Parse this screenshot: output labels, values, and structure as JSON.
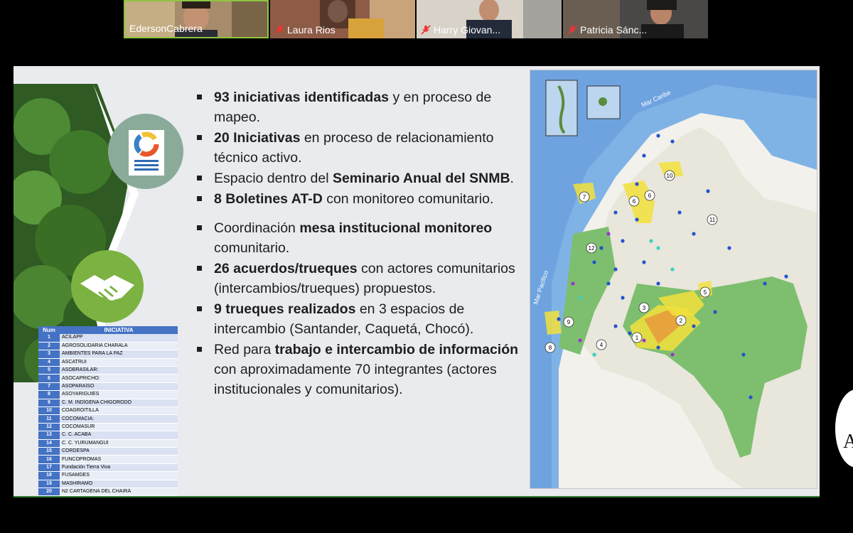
{
  "participants": [
    {
      "name": "EdersonCabrera",
      "muted": false,
      "active": true
    },
    {
      "name": "Laura Rios",
      "muted": true,
      "active": false
    },
    {
      "name": "Harry Giovan...",
      "muted": true,
      "active": false
    },
    {
      "name": "Patricia Sánc...",
      "muted": true,
      "active": false
    }
  ],
  "slide": {
    "bullets": [
      {
        "parts": [
          {
            "t": "93 iniciativas identificadas",
            "b": true
          },
          {
            "t": " y en proceso de mapeo.",
            "b": false
          }
        ]
      },
      {
        "parts": [
          {
            "t": "20 Iniciativas",
            "b": true
          },
          {
            "t": " en proceso de relacionamiento técnico activo.",
            "b": false
          }
        ]
      },
      {
        "parts": [
          {
            "t": "Espacio dentro del ",
            "b": false
          },
          {
            "t": "Seminario Anual del SNMB",
            "b": true
          },
          {
            "t": ".",
            "b": false
          }
        ]
      },
      {
        "parts": [
          {
            "t": "8 Boletines AT-D",
            "b": true
          },
          {
            "t": " con monitoreo comunitario.",
            "b": false
          }
        ]
      },
      {
        "parts": [
          {
            "t": "Coordinación ",
            "b": false
          },
          {
            "t": "mesa institucional monitoreo",
            "b": true
          },
          {
            "t": " comunitario.",
            "b": false
          }
        ]
      },
      {
        "parts": [
          {
            "t": "26 acuerdos/trueques",
            "b": true
          },
          {
            "t": " con actores comunitarios (intercambios/trueques) propuestos.",
            "b": false
          }
        ]
      },
      {
        "parts": [
          {
            "t": "9 trueques realizados",
            "b": true
          },
          {
            "t": " en 3 espacios de intercambio (Santander, Caquetá, Chocó).",
            "b": false
          }
        ]
      },
      {
        "parts": [
          {
            "t": "Red para ",
            "b": false
          },
          {
            "t": "trabajo e intercambio de información",
            "b": true
          },
          {
            "t": " con aproximadamente 70 integrantes (actores institucionales y comunitarios).",
            "b": false
          }
        ]
      }
    ],
    "table": {
      "headers": [
        "Num",
        "INICIATIVA"
      ],
      "rows": [
        [
          "1",
          "ACILAPP"
        ],
        [
          "2",
          "AGROSOLIDARIA CHARALA"
        ],
        [
          "3",
          "AMBIENTES PARA LA PAZ"
        ],
        [
          "4",
          "ASCATRUI"
        ],
        [
          "5",
          "ASOBRASILAR:"
        ],
        [
          "6",
          "ASOCAPRICHO:"
        ],
        [
          "7",
          "ASOPARAÍSO"
        ],
        [
          "8",
          "ASOYARIGUIES"
        ],
        [
          "9",
          "C. M. INDÍGENA CHIGORODÓ"
        ],
        [
          "10",
          "COAGROITILLA"
        ],
        [
          "11",
          "COCOMACIA:"
        ],
        [
          "12",
          "COCOMASUR"
        ],
        [
          "13",
          "C. C. ACABA"
        ],
        [
          "14",
          "C. C. YURUMANGUÍ"
        ],
        [
          "15",
          "CORDESPA"
        ],
        [
          "16",
          "FUNCOPROMAS"
        ],
        [
          "17",
          "Fundación Tierra Viva"
        ],
        [
          "18",
          "FUSAMDES"
        ],
        [
          "19",
          "MASHIRAMO"
        ],
        [
          "20",
          "N2 CARTAGENA DEL CHAIRÁ"
        ]
      ]
    },
    "map": {
      "labels": {
        "caribe": "Mar Caribe",
        "pacifico": "Mar Pacifico"
      },
      "region_numbers": [
        "10",
        "7",
        "6",
        "6",
        "11",
        "12",
        "5",
        "3",
        "2",
        "8",
        "9",
        "1",
        "4"
      ],
      "colors": {
        "sea": "#7fb3e6",
        "land": "#e9e6dc",
        "forest": "#7dbf6e",
        "highlight": "#f2e03c",
        "hot": "#e8923a",
        "point_blue": "#2255cc",
        "point_purple": "#9b38c9",
        "point_cyan": "#3fd0c0"
      }
    }
  }
}
